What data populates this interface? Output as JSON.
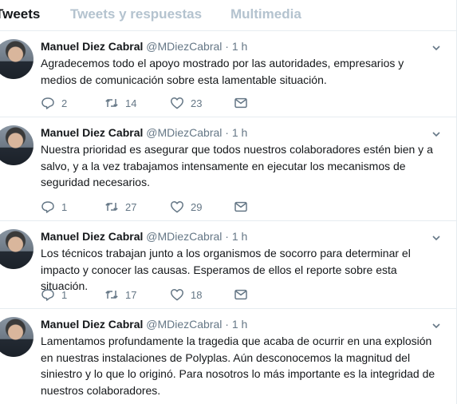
{
  "tabs": [
    {
      "label": "Tweets",
      "active": true
    },
    {
      "label": "Tweets y respuestas",
      "active": false
    },
    {
      "label": "Multimedia",
      "active": false
    }
  ],
  "tweets": [
    {
      "name": "Manuel Diez Cabral",
      "handle": "@MDiezCabral",
      "dot": "·",
      "time": "1 h",
      "text": "Agradecemos todo el apoyo mostrado por las autoridades, empresarios y medios de comunicación sobre esta lamentable situación.",
      "replies": "2",
      "retweets": "14",
      "likes": "23"
    },
    {
      "name": "Manuel Diez Cabral",
      "handle": "@MDiezCabral",
      "dot": "·",
      "time": "1 h",
      "text": "Nuestra prioridad es asegurar que todos nuestros colaboradores estén bien y a salvo, y a la vez trabajamos intensamente en ejecutar los mecanismos de seguridad necesarios.",
      "replies": "1",
      "retweets": "27",
      "likes": "29"
    },
    {
      "name": "Manuel Diez Cabral",
      "handle": "@MDiezCabral",
      "dot": "·",
      "time": "1 h",
      "text": "Los técnicos trabajan junto a los organismos de socorro para determinar el impacto y conocer las causas. Esperamos de ellos el reporte sobre esta situación.",
      "replies": "1",
      "retweets": "17",
      "likes": "18"
    },
    {
      "name": "Manuel Diez Cabral",
      "handle": "@MDiezCabral",
      "dot": "·",
      "time": "1 h",
      "text": "Lamentamos profundamente la tragedia que acaba de ocurrir en una explosión en nuestras instalaciones de Polyplas. Aún desconocemos la magnitud del siniestro y lo que lo originó. Para nosotros lo más importante es la integridad de nuestros colaboradores."
    }
  ],
  "icons": {
    "reply": "reply-icon",
    "retweet": "retweet-icon",
    "like": "heart-icon",
    "message": "envelope-icon",
    "menu": "chevron-down-icon"
  },
  "colors": {
    "text": "#14171a",
    "muted": "#657786",
    "inactive_tab": "#b4c3cf",
    "divider": "#e6ecf0"
  }
}
